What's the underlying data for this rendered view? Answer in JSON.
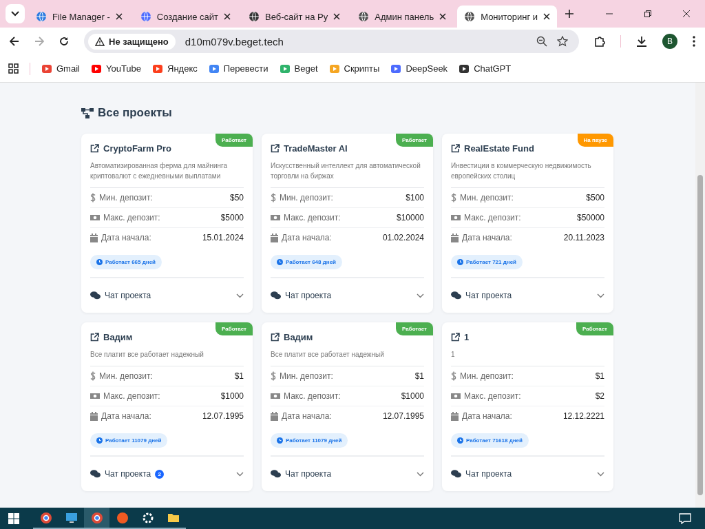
{
  "browser": {
    "tabs": [
      {
        "title": "File Manager -",
        "selected": false
      },
      {
        "title": "Создание сайт",
        "selected": false
      },
      {
        "title": "Веб-сайт на Ру",
        "selected": false
      },
      {
        "title": "Админ панель",
        "selected": false
      },
      {
        "title": "Мониторинг и",
        "selected": true
      }
    ],
    "address": {
      "security": "Не защищено",
      "url": "d10m079v.beget.tech"
    },
    "profile": "B",
    "bookmarks": [
      {
        "label": "Gmail"
      },
      {
        "label": "YouTube"
      },
      {
        "label": "Яндекс"
      },
      {
        "label": "Перевести"
      },
      {
        "label": "Beget"
      },
      {
        "label": "Скрипты"
      },
      {
        "label": "DeepSeek"
      },
      {
        "label": "ChatGPT"
      }
    ]
  },
  "page": {
    "heading": "Все проекты",
    "projects": [
      {
        "title": "CryptoFarm Pro",
        "description": "Автоматизированная ферма для майнинга криптовалют с ежедневными выплатами",
        "status": {
          "label": "Работает",
          "kind": "running"
        },
        "stats": [
          {
            "kind": "min",
            "label": "Мин. депозит:",
            "value": "$50"
          },
          {
            "kind": "max",
            "label": "Макс. депозит:",
            "value": "$5000"
          },
          {
            "kind": "date",
            "label": "Дата начала:",
            "value": "15.01.2024"
          }
        ],
        "uptime": "Работает 665 дней",
        "chat": {
          "label": "Чат проекта"
        }
      },
      {
        "title": "TradeMaster AI",
        "description": "Искусственный интеллект для автоматической торговли на биржах",
        "status": {
          "label": "Работает",
          "kind": "running"
        },
        "stats": [
          {
            "kind": "min",
            "label": "Мин. депозит:",
            "value": "$100"
          },
          {
            "kind": "max",
            "label": "Макс. депозит:",
            "value": "$10000"
          },
          {
            "kind": "date",
            "label": "Дата начала:",
            "value": "01.02.2024"
          }
        ],
        "uptime": "Работает 648 дней",
        "chat": {
          "label": "Чат проекта"
        }
      },
      {
        "title": "RealEstate Fund",
        "description": "Инвестиции в коммерческую недвижимость европейских столиц",
        "status": {
          "label": "На паузе",
          "kind": "paused"
        },
        "stats": [
          {
            "kind": "min",
            "label": "Мин. депозит:",
            "value": "$500"
          },
          {
            "kind": "max",
            "label": "Макс. депозит:",
            "value": "$50000"
          },
          {
            "kind": "date",
            "label": "Дата начала:",
            "value": "20.11.2023"
          }
        ],
        "uptime": "Работает 721 дней",
        "chat": {
          "label": "Чат проекта"
        }
      },
      {
        "title": "Вадим",
        "description": "Все платит все работает надежный",
        "status": {
          "label": "Работает",
          "kind": "running"
        },
        "stats": [
          {
            "kind": "min",
            "label": "Мин. депозит:",
            "value": "$1"
          },
          {
            "kind": "max",
            "label": "Макс. депозит:",
            "value": "$1000"
          },
          {
            "kind": "date",
            "label": "Дата начала:",
            "value": "12.07.1995"
          }
        ],
        "uptime": "Работает 11079 дней",
        "chat": {
          "label": "Чат проекта",
          "badge": "2"
        }
      },
      {
        "title": "Вадим",
        "description": "Все платит все работает надежный",
        "status": {
          "label": "Работает",
          "kind": "running"
        },
        "stats": [
          {
            "kind": "min",
            "label": "Мин. депозит:",
            "value": "$1"
          },
          {
            "kind": "max",
            "label": "Макс. депозит:",
            "value": "$1000"
          },
          {
            "kind": "date",
            "label": "Дата начала:",
            "value": "12.07.1995"
          }
        ],
        "uptime": "Работает 11079 дней",
        "chat": {
          "label": "Чат проекта"
        }
      },
      {
        "title": "1",
        "description": "1",
        "status": {
          "label": "Работает",
          "kind": "running"
        },
        "stats": [
          {
            "kind": "min",
            "label": "Мин. депозит:",
            "value": "$1"
          },
          {
            "kind": "max",
            "label": "Макс. депозит:",
            "value": "$2"
          },
          {
            "kind": "date",
            "label": "Дата начала:",
            "value": "12.12.2221"
          }
        ],
        "uptime": "Работает 71618 дней",
        "chat": {
          "label": "Чат проекта"
        }
      }
    ]
  },
  "taskbar": {
    "items": [
      {
        "kind": "chrome",
        "selected": false
      },
      {
        "kind": "desktop",
        "selected": false
      },
      {
        "kind": "chrome",
        "selected": true
      },
      {
        "kind": "ea",
        "selected": false
      },
      {
        "kind": "gear",
        "selected": false
      },
      {
        "kind": "folder",
        "selected": false
      }
    ]
  }
}
